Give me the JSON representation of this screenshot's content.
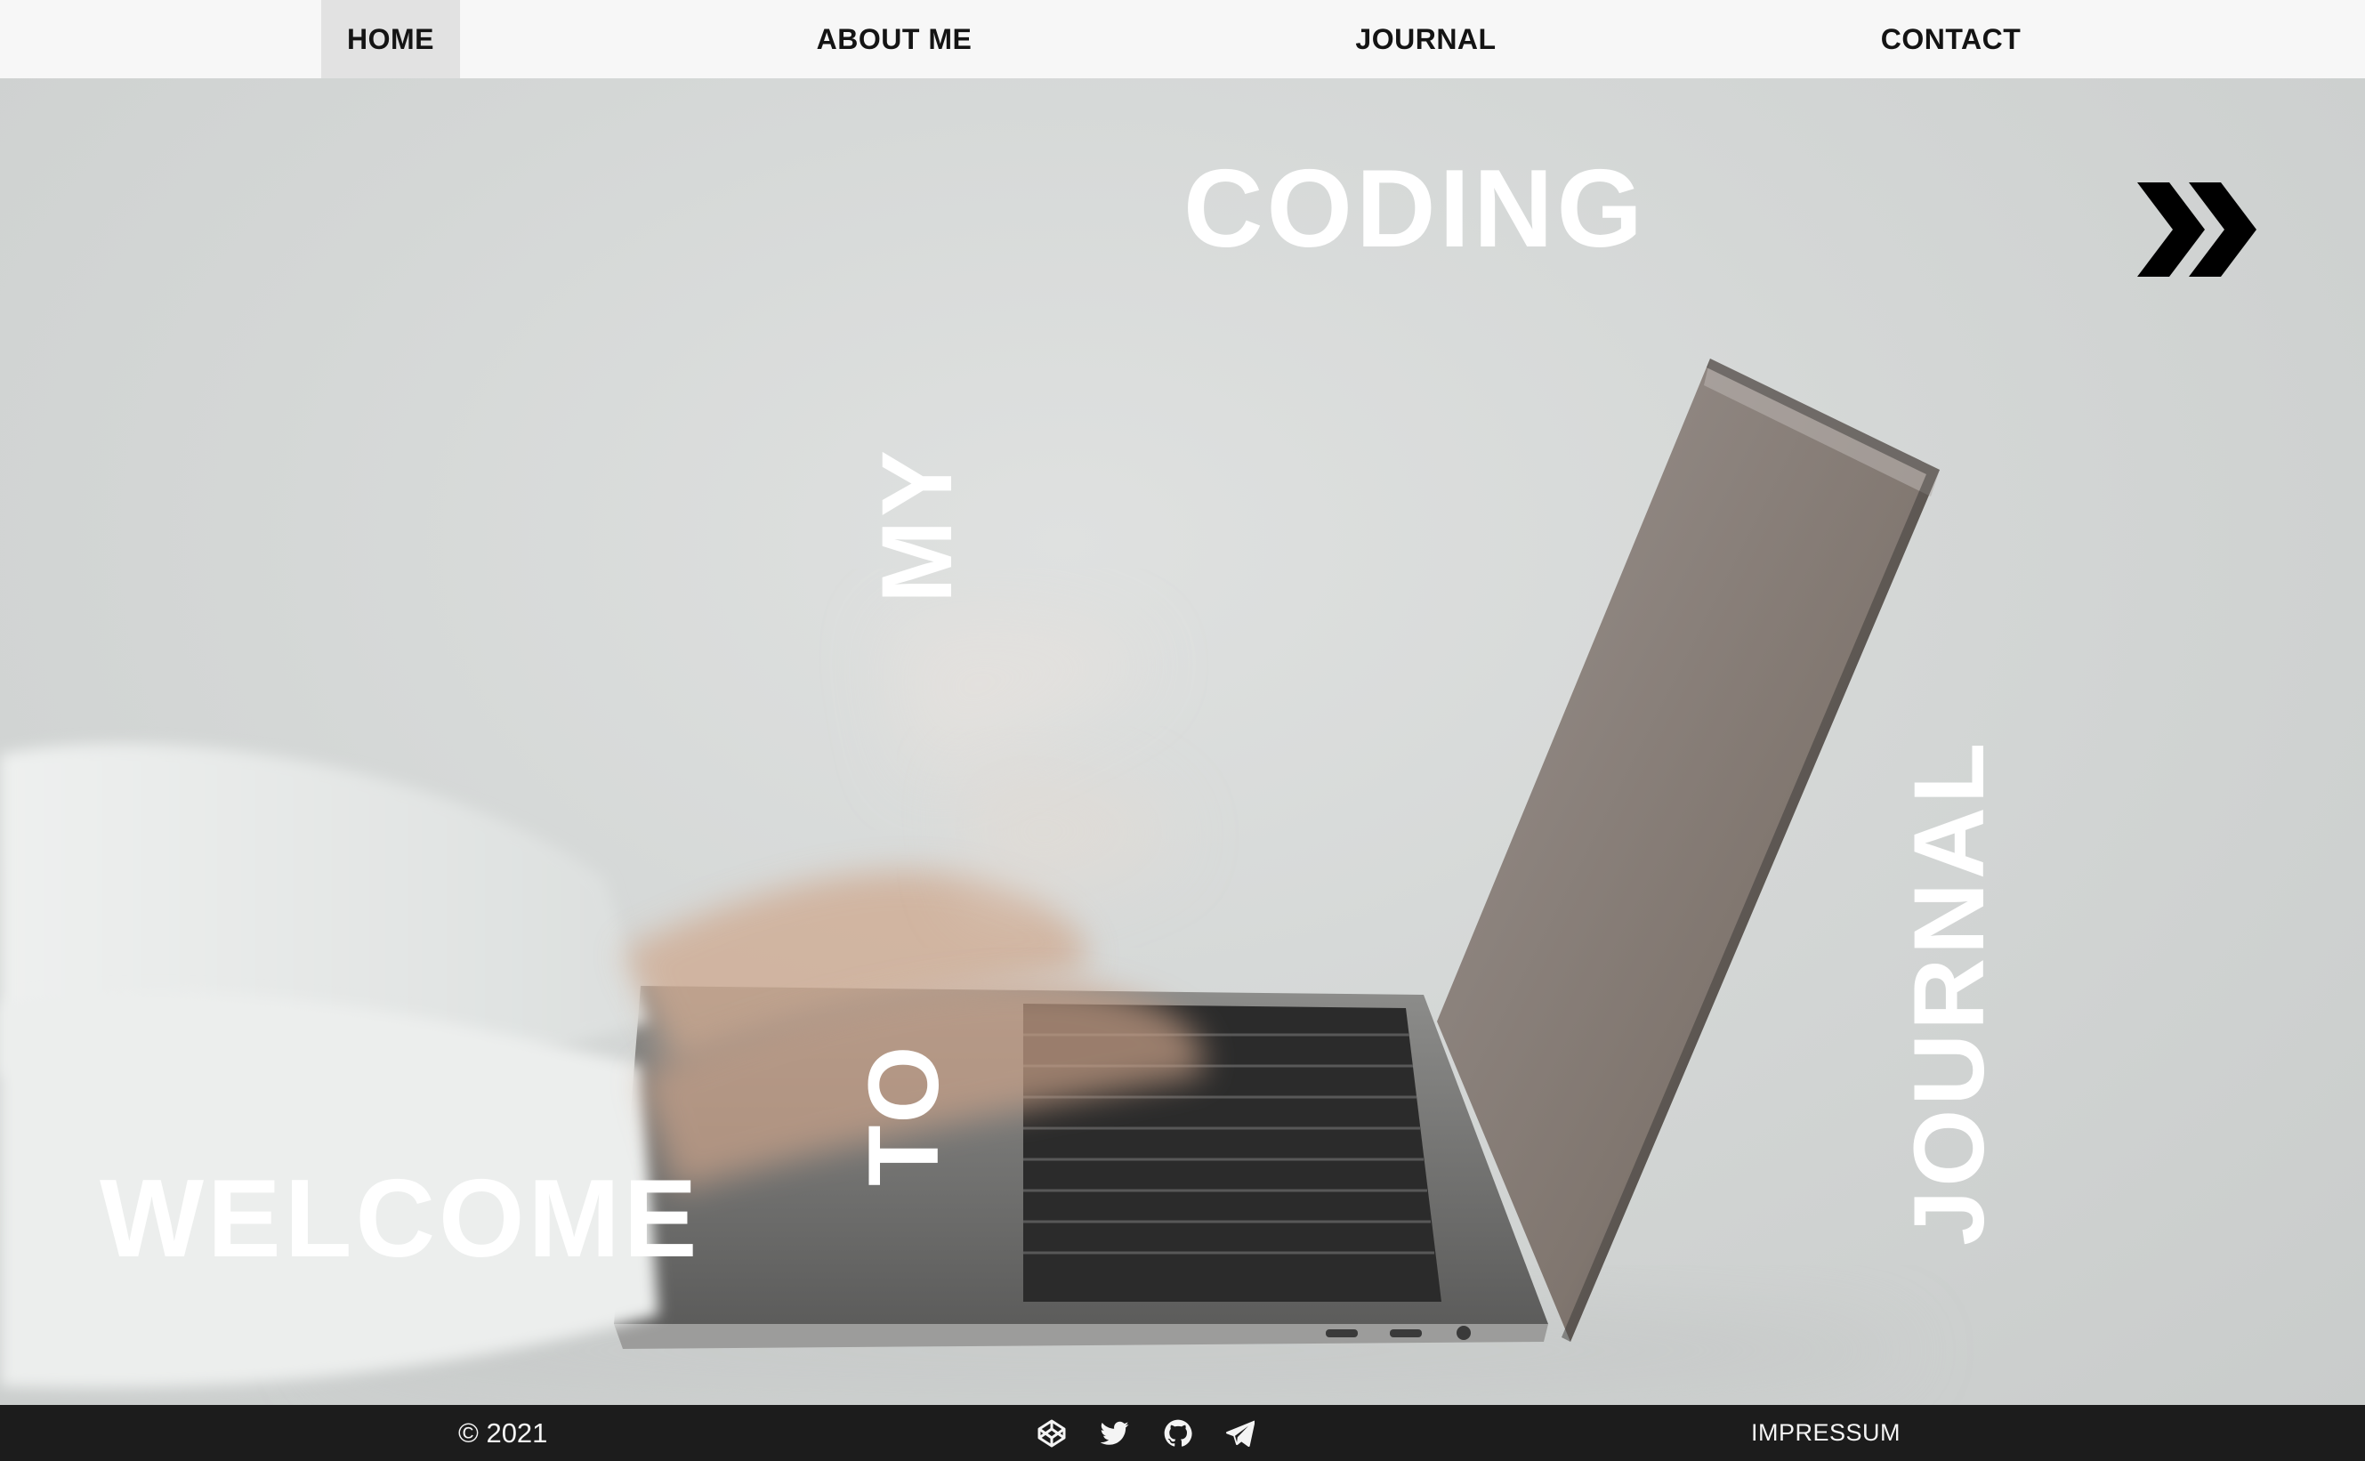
{
  "nav": {
    "items": [
      {
        "label": "HOME",
        "active": true
      },
      {
        "label": "ABOUT ME"
      },
      {
        "label": "JOURNAL"
      },
      {
        "label": "CONTACT"
      }
    ]
  },
  "hero": {
    "words": {
      "welcome": "WELCOME",
      "to": "TO",
      "my": "MY",
      "coding": "CODING",
      "journal": "JOURNAL"
    },
    "next_icon": "double-chevron-right-icon"
  },
  "footer": {
    "copyright": "© 2021",
    "social_icons": [
      "codepen-icon",
      "twitter-icon",
      "github-icon",
      "telegram-icon"
    ],
    "impressum": "IMPRESSUM"
  },
  "colors": {
    "nav_bg": "#f7f7f7",
    "nav_active_bg": "#e2e2e2",
    "hero_bg": "#d3d6d5",
    "hero_text": "#ffffff",
    "footer_bg": "#1c1c1c",
    "footer_text": "#f4f4f4"
  }
}
